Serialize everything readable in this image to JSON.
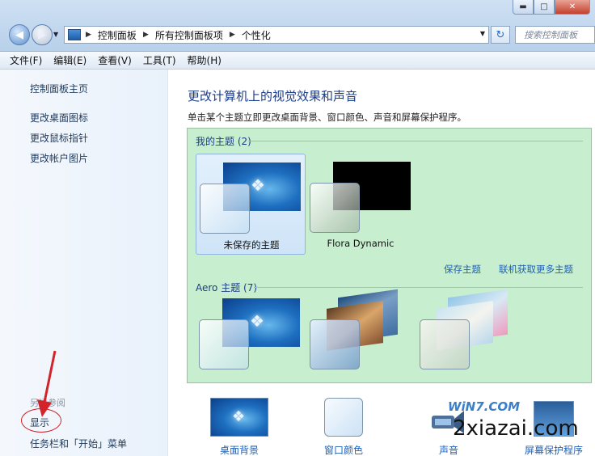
{
  "window": {
    "minimize_glyph": "▬",
    "maximize_glyph": "□",
    "close_glyph": "✕"
  },
  "address_bar": {
    "crumbs": [
      "控制面板",
      "所有控制面板项",
      "个性化"
    ],
    "search_placeholder": "搜索控制面板"
  },
  "menu": {
    "items": [
      "文件(F)",
      "编辑(E)",
      "查看(V)",
      "工具(T)",
      "帮助(H)"
    ]
  },
  "sidebar": {
    "home_link": "控制面板主页",
    "links": [
      "更改桌面图标",
      "更改鼠标指针",
      "更改帐户图片"
    ],
    "see_also_title": "另请参阅",
    "see_also_links": [
      "显示",
      "任务栏和「开始」菜单"
    ]
  },
  "main": {
    "heading": "更改计算机上的视觉效果和声音",
    "subtext": "单击某个主题立即更改桌面背景、窗口颜色、声音和屏幕保护程序。",
    "my_themes_title": "我的主题 (2)",
    "my_themes": [
      "未保存的主题",
      "Flora Dynamic"
    ],
    "save_theme_link": "保存主题",
    "get_more_link": "联机获取更多主题",
    "aero_title": "Aero 主题 (7)"
  },
  "bottom": {
    "items": [
      "桌面背景",
      "窗口颜色",
      "声音",
      "屏幕保护程序"
    ]
  },
  "watermark": {
    "logo": "WiN7.COM",
    "site": "2xiazai.com"
  },
  "colors": {
    "theme_panel": "#c7efcf",
    "link": "#1f60b6",
    "heading": "#1c3d88",
    "annotation": "#d2232a"
  }
}
